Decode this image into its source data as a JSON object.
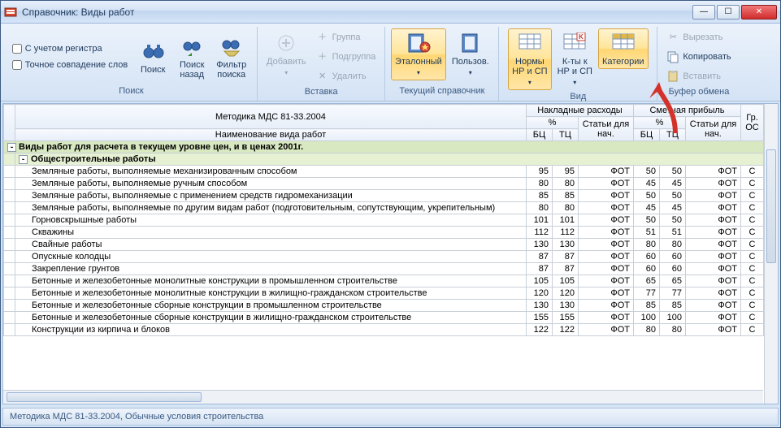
{
  "window": {
    "title": "Справочник: Виды работ"
  },
  "ribbon": {
    "search_group": {
      "label": "Поиск",
      "chk_case": "С учетом регистра",
      "chk_exact": "Точное совпадение слов",
      "btn_search": "Поиск",
      "btn_search_back": "Поиск\nназад",
      "btn_filter": "Фильтр\nпоиска"
    },
    "insert_group": {
      "label": "Вставка",
      "btn_add": "Добавить",
      "btn_group": "Группа",
      "btn_subgroup": "Подгруппа",
      "btn_delete": "Удалить"
    },
    "dir_group": {
      "label": "Текущий справочник",
      "btn_ref": "Эталонный",
      "btn_user": "Пользов."
    },
    "view_group": {
      "label": "Вид",
      "btn_norms": "Нормы\nНР и СП",
      "btn_coef": "К-ты к\nНР и СП",
      "btn_cat": "Категории"
    },
    "clip_group": {
      "label": "Буфер обмена",
      "btn_cut": "Вырезать",
      "btn_copy": "Копировать",
      "btn_paste": "Вставить"
    }
  },
  "table": {
    "method_header": "Методика МДС 81-33.2004",
    "name_header": "Наименование вида работ",
    "nr_header": "Накладные расходы",
    "sp_header": "Сметная прибыль",
    "pct": "%",
    "art": "Статьи для нач.",
    "bc": "БЦ",
    "tc": "ТЦ",
    "gros": "Гр. ОС",
    "section1": "Виды работ для расчета в текущем уровне цен, и в ценах 2001г.",
    "section2": "Общестроительные работы",
    "rows": [
      {
        "name": "Земляные работы, выполняемые механизированным способом",
        "nr_bc": 95,
        "nr_tc": 95,
        "nr_art": "ФОТ",
        "sp_bc": 50,
        "sp_tc": 50,
        "sp_art": "ФОТ",
        "g": "С"
      },
      {
        "name": "Земляные работы, выполняемые ручным способом",
        "nr_bc": 80,
        "nr_tc": 80,
        "nr_art": "ФОТ",
        "sp_bc": 45,
        "sp_tc": 45,
        "sp_art": "ФОТ",
        "g": "С"
      },
      {
        "name": "Земляные работы, выполняемые с применением средств гидромеханизации",
        "nr_bc": 85,
        "nr_tc": 85,
        "nr_art": "ФОТ",
        "sp_bc": 50,
        "sp_tc": 50,
        "sp_art": "ФОТ",
        "g": "С"
      },
      {
        "name": "Земляные работы, выполняемые по другим видам работ (подготовительным, сопутствующим, укрепительным)",
        "nr_bc": 80,
        "nr_tc": 80,
        "nr_art": "ФОТ",
        "sp_bc": 45,
        "sp_tc": 45,
        "sp_art": "ФОТ",
        "g": "С"
      },
      {
        "name": "Горновскрышные работы",
        "nr_bc": 101,
        "nr_tc": 101,
        "nr_art": "ФОТ",
        "sp_bc": 50,
        "sp_tc": 50,
        "sp_art": "ФОТ",
        "g": "С"
      },
      {
        "name": "Скважины",
        "nr_bc": 112,
        "nr_tc": 112,
        "nr_art": "ФОТ",
        "sp_bc": 51,
        "sp_tc": 51,
        "sp_art": "ФОТ",
        "g": "С"
      },
      {
        "name": "Свайные работы",
        "nr_bc": 130,
        "nr_tc": 130,
        "nr_art": "ФОТ",
        "sp_bc": 80,
        "sp_tc": 80,
        "sp_art": "ФОТ",
        "g": "С"
      },
      {
        "name": "Опускные колодцы",
        "nr_bc": 87,
        "nr_tc": 87,
        "nr_art": "ФОТ",
        "sp_bc": 60,
        "sp_tc": 60,
        "sp_art": "ФОТ",
        "g": "С"
      },
      {
        "name": "Закрепление грунтов",
        "nr_bc": 87,
        "nr_tc": 87,
        "nr_art": "ФОТ",
        "sp_bc": 60,
        "sp_tc": 60,
        "sp_art": "ФОТ",
        "g": "С"
      },
      {
        "name": "Бетонные и железобетонные монолитные конструкции в промышленном строительстве",
        "nr_bc": 105,
        "nr_tc": 105,
        "nr_art": "ФОТ",
        "sp_bc": 65,
        "sp_tc": 65,
        "sp_art": "ФОТ",
        "g": "С"
      },
      {
        "name": "Бетонные и железобетонные монолитные конструкции в жилищно-гражданском строительстве",
        "nr_bc": 120,
        "nr_tc": 120,
        "nr_art": "ФОТ",
        "sp_bc": 77,
        "sp_tc": 77,
        "sp_art": "ФОТ",
        "g": "С"
      },
      {
        "name": "Бетонные и железобетонные сборные конструкции в промышленном строительстве",
        "nr_bc": 130,
        "nr_tc": 130,
        "nr_art": "ФОТ",
        "sp_bc": 85,
        "sp_tc": 85,
        "sp_art": "ФОТ",
        "g": "С"
      },
      {
        "name": "Бетонные и железобетонные сборные конструкции в жилищно-гражданском строительстве",
        "nr_bc": 155,
        "nr_tc": 155,
        "nr_art": "ФОТ",
        "sp_bc": 100,
        "sp_tc": 100,
        "sp_art": "ФОТ",
        "g": "С"
      },
      {
        "name": "Конструкции из кирпича и блоков",
        "nr_bc": 122,
        "nr_tc": 122,
        "nr_art": "ФОТ",
        "sp_bc": 80,
        "sp_tc": 80,
        "sp_art": "ФОТ",
        "g": "С"
      }
    ]
  },
  "statusbar": {
    "text": "Методика МДС 81-33.2004, Обычные условия строительства"
  }
}
